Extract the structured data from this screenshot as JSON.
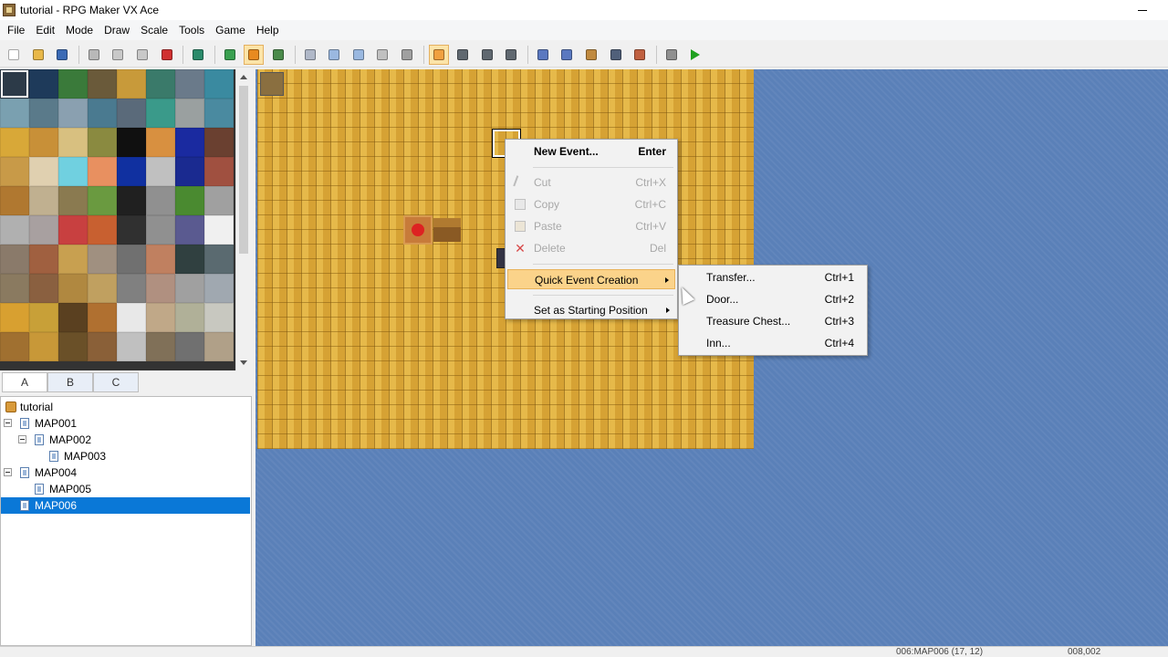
{
  "window": {
    "title": "tutorial - RPG Maker VX Ace"
  },
  "menubar": [
    "File",
    "Edit",
    "Mode",
    "Draw",
    "Scale",
    "Tools",
    "Game",
    "Help"
  ],
  "toolbar": {
    "groups": [
      [
        {
          "name": "new-project-icon",
          "color": "#ffffff"
        },
        {
          "name": "open-project-icon",
          "color": "#e8b84a"
        },
        {
          "name": "save-project-icon",
          "color": "#3a6ab5"
        }
      ],
      [
        {
          "name": "cut-icon",
          "color": "#b8b8b8"
        },
        {
          "name": "copy-icon",
          "color": "#c8c8c8"
        },
        {
          "name": "paste-icon",
          "color": "#c8c8c8"
        },
        {
          "name": "delete-icon",
          "color": "#d03030"
        }
      ],
      [
        {
          "name": "undo-icon",
          "color": "#2a8a6a"
        }
      ],
      [
        {
          "name": "map-mode-icon",
          "color": "#3aa050"
        },
        {
          "name": "event-mode-icon",
          "color": "#e88a20",
          "active": true
        },
        {
          "name": "region-mode-icon",
          "color": "#4a8a4a"
        }
      ],
      [
        {
          "name": "pencil-icon",
          "color": "#b0b8c8"
        },
        {
          "name": "rectangle-icon",
          "color": "#9ab8e0"
        },
        {
          "name": "ellipse-icon",
          "color": "#9ab8e0"
        },
        {
          "name": "fill-icon",
          "color": "#c0c0c0"
        },
        {
          "name": "shadow-pen-icon",
          "color": "#a0a0a0"
        }
      ],
      [
        {
          "name": "scale-1-1-icon",
          "color": "#f0a040",
          "active": true
        },
        {
          "name": "scale-1-2-icon",
          "color": "#606870"
        },
        {
          "name": "scale-1-4-icon",
          "color": "#606870"
        },
        {
          "name": "scale-1-8-icon",
          "color": "#606870"
        }
      ],
      [
        {
          "name": "database-icon",
          "color": "#5a78c0"
        },
        {
          "name": "resource-manager-icon",
          "color": "#5a78c0"
        },
        {
          "name": "script-editor-icon",
          "color": "#c08a40"
        },
        {
          "name": "sound-test-icon",
          "color": "#50607a"
        },
        {
          "name": "character-generator-icon",
          "color": "#c06040"
        }
      ],
      [
        {
          "name": "options-icon",
          "color": "#909090"
        },
        {
          "name": "playtest-icon",
          "color": "#20a020"
        }
      ]
    ]
  },
  "tileset": {
    "colors": [
      "#2c3a48",
      "#1e3a5a",
      "#3a7a3a",
      "#6a5a3a",
      "#c89a3a",
      "#3a7a6a",
      "#6a7a8a",
      "#3a8aa0",
      "#7aa0b0",
      "#5a7a8a",
      "#8aa0b0",
      "#4a7a90",
      "#5a6a7a",
      "#3a9a8a",
      "#9aa0a0",
      "#4a8aa0",
      "#d8a838",
      "#c89038",
      "#d8c080",
      "#8a8a40",
      "#101010",
      "#d89040",
      "#1a2aa0",
      "#6a4030",
      "#c89a48",
      "#e0d0b0",
      "#70d0e0",
      "#e89060",
      "#1030a0",
      "#c0c0c0",
      "#1a2a90",
      "#a05040",
      "#b07830",
      "#c0b090",
      "#8a7a50",
      "#6a9a40",
      "#202020",
      "#909090",
      "#4a8a30",
      "#a0a0a0",
      "#b0b0b0",
      "#a8a0a0",
      "#c84040",
      "#c86030",
      "#303030",
      "#909090",
      "#5a5a90",
      "#f0f0f0",
      "#8a7a6a",
      "#a06040",
      "#c8a050",
      "#a09080",
      "#707070",
      "#c08060",
      "#304040",
      "#5a6a70",
      "#8a7a60",
      "#8a6040",
      "#b08840",
      "#c0a060",
      "#808080",
      "#b09080",
      "#a0a0a0",
      "#a0a8b0",
      "#d8a030",
      "#c8a038",
      "#5a4020",
      "#b07030",
      "#e8e8e8",
      "#c0a888",
      "#b0b098",
      "#c8c8c0",
      "#a07030",
      "#c89838",
      "#6a5028",
      "#8a6038",
      "#c0c0c0",
      "#807058",
      "#707070",
      "#b0a088"
    ]
  },
  "tabs": [
    "A",
    "B",
    "C"
  ],
  "map_tree": {
    "rows": [
      {
        "label": "tutorial",
        "indent": 0,
        "kind": "root",
        "expander": false,
        "selected": false
      },
      {
        "label": "MAP001",
        "indent": 1,
        "kind": "map",
        "expander": true,
        "selected": false
      },
      {
        "label": "MAP002",
        "indent": 2,
        "kind": "map",
        "expander": true,
        "selected": false
      },
      {
        "label": "MAP003",
        "indent": 3,
        "kind": "map",
        "expander": false,
        "selected": false
      },
      {
        "label": "MAP004",
        "indent": 1,
        "kind": "map",
        "expander": true,
        "selected": false
      },
      {
        "label": "MAP005",
        "indent": 2,
        "kind": "map",
        "expander": false,
        "selected": false
      },
      {
        "label": "MAP006",
        "indent": 1,
        "kind": "map",
        "expander": false,
        "selected": true
      }
    ]
  },
  "context_menu": {
    "items": [
      {
        "label": "New Event...",
        "shortcut": "Enter",
        "state": "bold",
        "icon": ""
      },
      {
        "sep": true
      },
      {
        "label": "Cut",
        "shortcut": "Ctrl+X",
        "state": "disabled",
        "icon": "icon-cut"
      },
      {
        "label": "Copy",
        "shortcut": "Ctrl+C",
        "state": "disabled",
        "icon": "icon-copy"
      },
      {
        "label": "Paste",
        "shortcut": "Ctrl+V",
        "state": "disabled",
        "icon": "icon-paste"
      },
      {
        "label": "Delete",
        "shortcut": "Del",
        "state": "disabled",
        "icon": "icon-delete"
      },
      {
        "sep": true
      },
      {
        "label": "Quick Event Creation",
        "shortcut": "",
        "state": "hl",
        "submenu": true
      },
      {
        "sep": true
      },
      {
        "label": "Set as Starting Position",
        "shortcut": "",
        "state": "normal",
        "submenu": true
      }
    ]
  },
  "submenu": {
    "items": [
      {
        "label": "Transfer...",
        "shortcut": "Ctrl+1"
      },
      {
        "label": "Door...",
        "shortcut": "Ctrl+2"
      },
      {
        "label": "Treasure Chest...",
        "shortcut": "Ctrl+3"
      },
      {
        "label": "Inn...",
        "shortcut": "Ctrl+4"
      }
    ]
  },
  "status": {
    "left": "006:MAP006 (17, 12)",
    "right": "008,002"
  }
}
